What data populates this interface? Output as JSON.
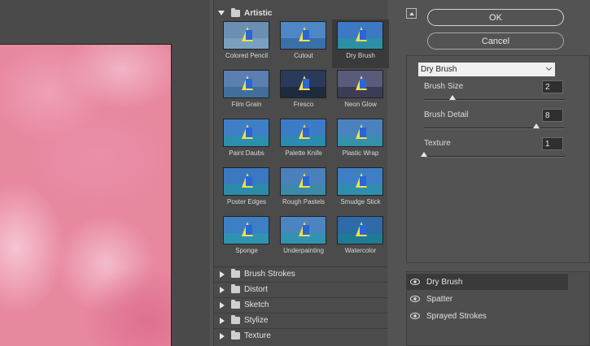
{
  "gallery": {
    "open_category": "Artistic",
    "thumbnails": [
      {
        "label": "Colored Pencil",
        "sky": "#6a8fb2",
        "sea": "#7aa0c0",
        "selected": false
      },
      {
        "label": "Cutout",
        "sky": "#4f86c6",
        "sea": "#3a6fa8",
        "selected": false
      },
      {
        "label": "Dry Brush",
        "sky": "#3d78c4",
        "sea": "#2b8fa6",
        "selected": true
      },
      {
        "label": "Film Grain",
        "sky": "#5a7fb0",
        "sea": "#3f6f9a",
        "selected": false
      },
      {
        "label": "Fresco",
        "sky": "#2a3a5a",
        "sea": "#1e2a3e",
        "selected": false
      },
      {
        "label": "Neon Glow",
        "sky": "#5a5a7a",
        "sea": "#3c3c55",
        "selected": false
      },
      {
        "label": "Paint Daubs",
        "sky": "#3f7fc8",
        "sea": "#2d8fb0",
        "selected": false
      },
      {
        "label": "Palette Knife",
        "sky": "#3c7cc6",
        "sea": "#2a8ab0",
        "selected": false
      },
      {
        "label": "Plastic Wrap",
        "sky": "#4a82bf",
        "sea": "#3690ac",
        "selected": false
      },
      {
        "label": "Poster Edges",
        "sky": "#3a78c0",
        "sea": "#2a8caa",
        "selected": false
      },
      {
        "label": "Rough Pastels",
        "sky": "#4a80bc",
        "sea": "#3a8aa8",
        "selected": false
      },
      {
        "label": "Smudge Stick",
        "sky": "#3e7ec4",
        "sea": "#2e8eae",
        "selected": false
      },
      {
        "label": "Sponge",
        "sky": "#3c7fc4",
        "sea": "#2d93b0",
        "selected": false
      },
      {
        "label": "Underpainting",
        "sky": "#4c84c2",
        "sea": "#3292b2",
        "selected": false
      },
      {
        "label": "Watercolor",
        "sky": "#2f6aa8",
        "sea": "#1f7a96",
        "selected": false
      }
    ],
    "categories": [
      "Brush Strokes",
      "Distort",
      "Sketch",
      "Stylize",
      "Texture"
    ]
  },
  "buttons": {
    "ok": "OK",
    "cancel": "Cancel"
  },
  "settings": {
    "filter_select": "Dry Brush",
    "params": [
      {
        "label": "Brush Size",
        "value": "2",
        "fraction": 0.2
      },
      {
        "label": "Brush Detail",
        "value": "8",
        "fraction": 0.8
      },
      {
        "label": "Texture",
        "value": "1",
        "fraction": 0.0
      }
    ]
  },
  "layers": [
    {
      "name": "Dry Brush",
      "active": true
    },
    {
      "name": "Spatter",
      "active": false
    },
    {
      "name": "Sprayed Strokes",
      "active": false
    }
  ],
  "colors": {
    "selected_bg": "#3a3a3a",
    "panel_bg": "#535353",
    "gallery_bg": "#4b4b4b"
  }
}
